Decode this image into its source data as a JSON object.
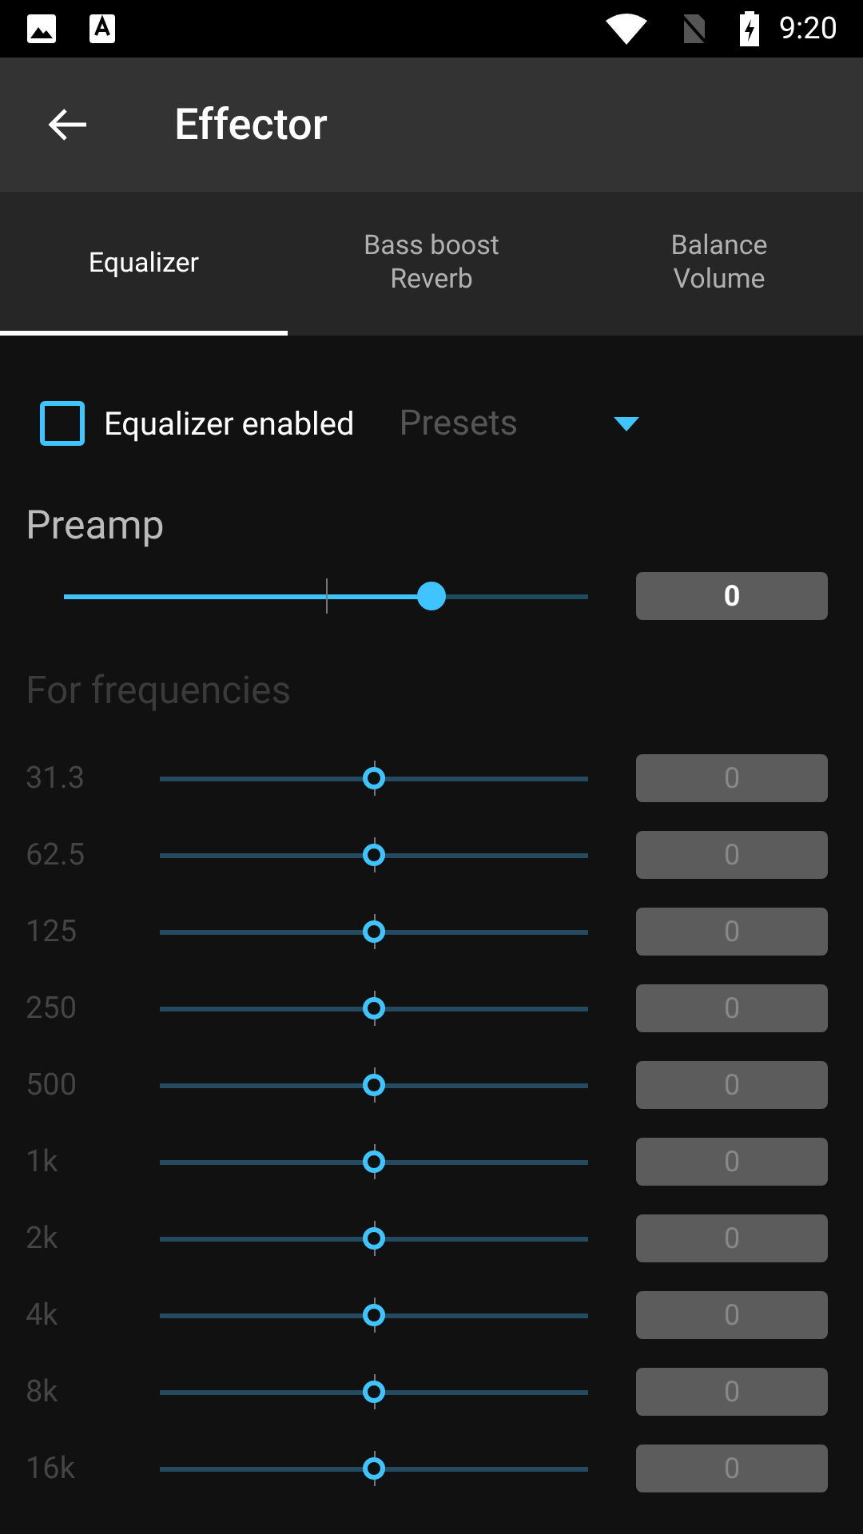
{
  "status_bar": {
    "time": "9:20"
  },
  "app_bar": {
    "title": "Effector"
  },
  "tabs": [
    {
      "label": "Equalizer",
      "selected": true
    },
    {
      "label": "Bass boost\nReverb",
      "selected": false
    },
    {
      "label": "Balance\nVolume",
      "selected": false
    }
  ],
  "equalizer": {
    "enabled_label": "Equalizer enabled",
    "checked": false,
    "presets": {
      "placeholder": "Presets"
    }
  },
  "preamp": {
    "label": "Preamp",
    "level": 0.7,
    "value": "0"
  },
  "frequencies": {
    "label": "For frequencies",
    "disabled": true,
    "bands": [
      {
        "name": "31.3",
        "level": 0.5,
        "value": "0"
      },
      {
        "name": "62.5",
        "level": 0.5,
        "value": "0"
      },
      {
        "name": "125",
        "level": 0.5,
        "value": "0"
      },
      {
        "name": "250",
        "level": 0.5,
        "value": "0"
      },
      {
        "name": "500",
        "level": 0.5,
        "value": "0"
      },
      {
        "name": "1k",
        "level": 0.5,
        "value": "0"
      },
      {
        "name": "2k",
        "level": 0.5,
        "value": "0"
      },
      {
        "name": "4k",
        "level": 0.5,
        "value": "0"
      },
      {
        "name": "8k",
        "level": 0.5,
        "value": "0"
      },
      {
        "name": "16k",
        "level": 0.5,
        "value": "0"
      }
    ]
  }
}
